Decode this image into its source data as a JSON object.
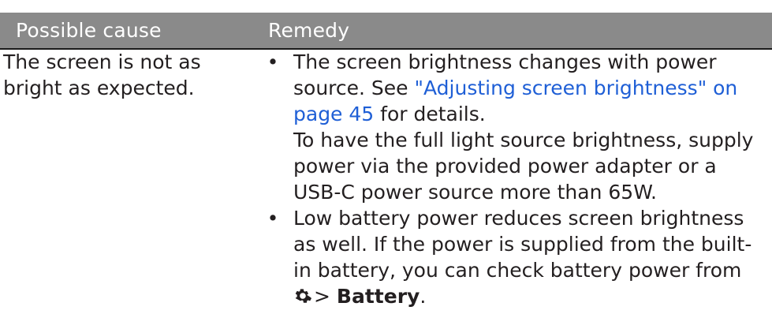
{
  "table": {
    "headers": {
      "cause": "Possible cause",
      "remedy": "Remedy"
    },
    "row": {
      "cause_line1": "The screen is not as",
      "cause_line2": "bright as expected.",
      "remedy1": {
        "text_before_link": "The screen brightness changes with power source. See ",
        "link": "\"Adjusting screen brightness\" on page 45",
        "text_after_link": " for details.",
        "extra": "To have the full light source brightness, supply power via the provided power adapter or a USB-C power source more than 65W."
      },
      "remedy2": {
        "text": "Low battery power reduces screen brightness as well. If the power is supplied from the built-in battery, you can check battery power from ",
        "separator": ">",
        "bold_target": "Battery",
        "end": "."
      }
    }
  },
  "colors": {
    "header_bg": "#8a8a8a",
    "link": "#1f5fd6"
  },
  "icons": {
    "settings": "gear-icon"
  }
}
